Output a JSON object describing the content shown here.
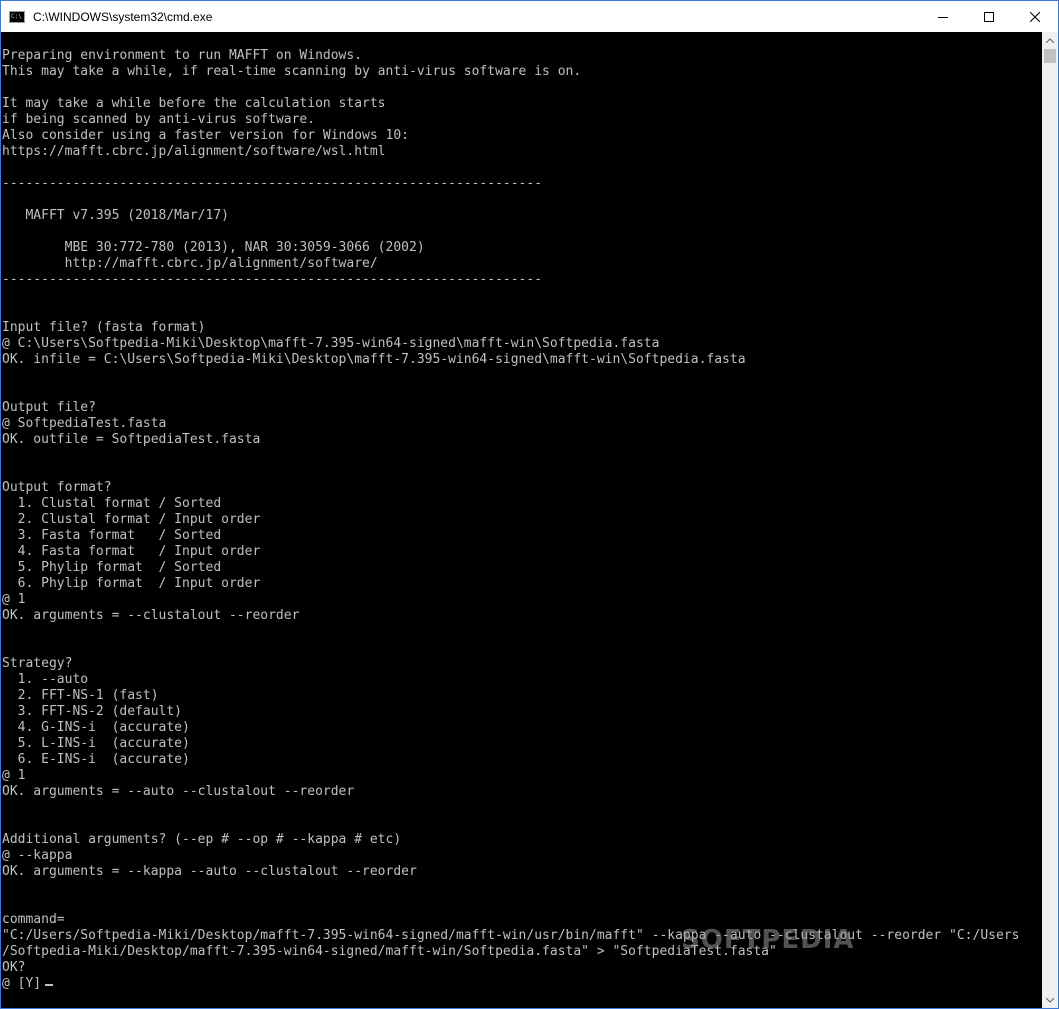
{
  "window": {
    "title": "C:\\WINDOWS\\system32\\cmd.exe",
    "icon_text": "C:\\"
  },
  "console": {
    "lines": [
      "Preparing environment to run MAFFT on Windows.",
      "This may take a while, if real-time scanning by anti-virus software is on.",
      "",
      "It may take a while before the calculation starts",
      "if being scanned by anti-virus software.",
      "Also consider using a faster version for Windows 10:",
      "https://mafft.cbrc.jp/alignment/software/wsl.html",
      "",
      "---------------------------------------------------------------------",
      "",
      "   MAFFT v7.395 (2018/Mar/17)",
      "",
      "        MBE 30:772-780 (2013), NAR 30:3059-3066 (2002)",
      "        http://mafft.cbrc.jp/alignment/software/",
      "---------------------------------------------------------------------",
      "",
      "",
      "Input file? (fasta format)",
      "@ C:\\Users\\Softpedia-Miki\\Desktop\\mafft-7.395-win64-signed\\mafft-win\\Softpedia.fasta",
      "OK. infile = C:\\Users\\Softpedia-Miki\\Desktop\\mafft-7.395-win64-signed\\mafft-win\\Softpedia.fasta",
      "",
      "",
      "Output file?",
      "@ SoftpediaTest.fasta",
      "OK. outfile = SoftpediaTest.fasta",
      "",
      "",
      "Output format?",
      "  1. Clustal format / Sorted",
      "  2. Clustal format / Input order",
      "  3. Fasta format   / Sorted",
      "  4. Fasta format   / Input order",
      "  5. Phylip format  / Sorted",
      "  6. Phylip format  / Input order",
      "@ 1",
      "OK. arguments = --clustalout --reorder",
      "",
      "",
      "Strategy?",
      "  1. --auto",
      "  2. FFT-NS-1 (fast)",
      "  3. FFT-NS-2 (default)",
      "  4. G-INS-i  (accurate)",
      "  5. L-INS-i  (accurate)",
      "  6. E-INS-i  (accurate)",
      "@ 1",
      "OK. arguments = --auto --clustalout --reorder",
      "",
      "",
      "Additional arguments? (--ep # --op # --kappa # etc)",
      "@ --kappa",
      "OK. arguments = --kappa --auto --clustalout --reorder",
      "",
      "",
      "command=",
      "\"C:/Users/Softpedia-Miki/Desktop/mafft-7.395-win64-signed/mafft-win/usr/bin/mafft\" --kappa --auto --clustalout --reorder \"C:/Users",
      "/Softpedia-Miki/Desktop/mafft-7.395-win64-signed/mafft-win/Softpedia.fasta\" > \"SoftpediaTest.fasta\"",
      "OK?",
      "@ [Y]"
    ]
  },
  "watermark": "SOFTPEDIA",
  "colors": {
    "console_bg": "#000000",
    "console_fg": "#c0c0c0",
    "titlebar_bg": "#ffffff",
    "border": "#3c78d8"
  },
  "icons": {
    "minimize": "minimize-icon",
    "maximize": "maximize-icon",
    "close": "close-icon",
    "scroll_up": "scroll-up-icon",
    "scroll_down": "scroll-down-icon"
  }
}
